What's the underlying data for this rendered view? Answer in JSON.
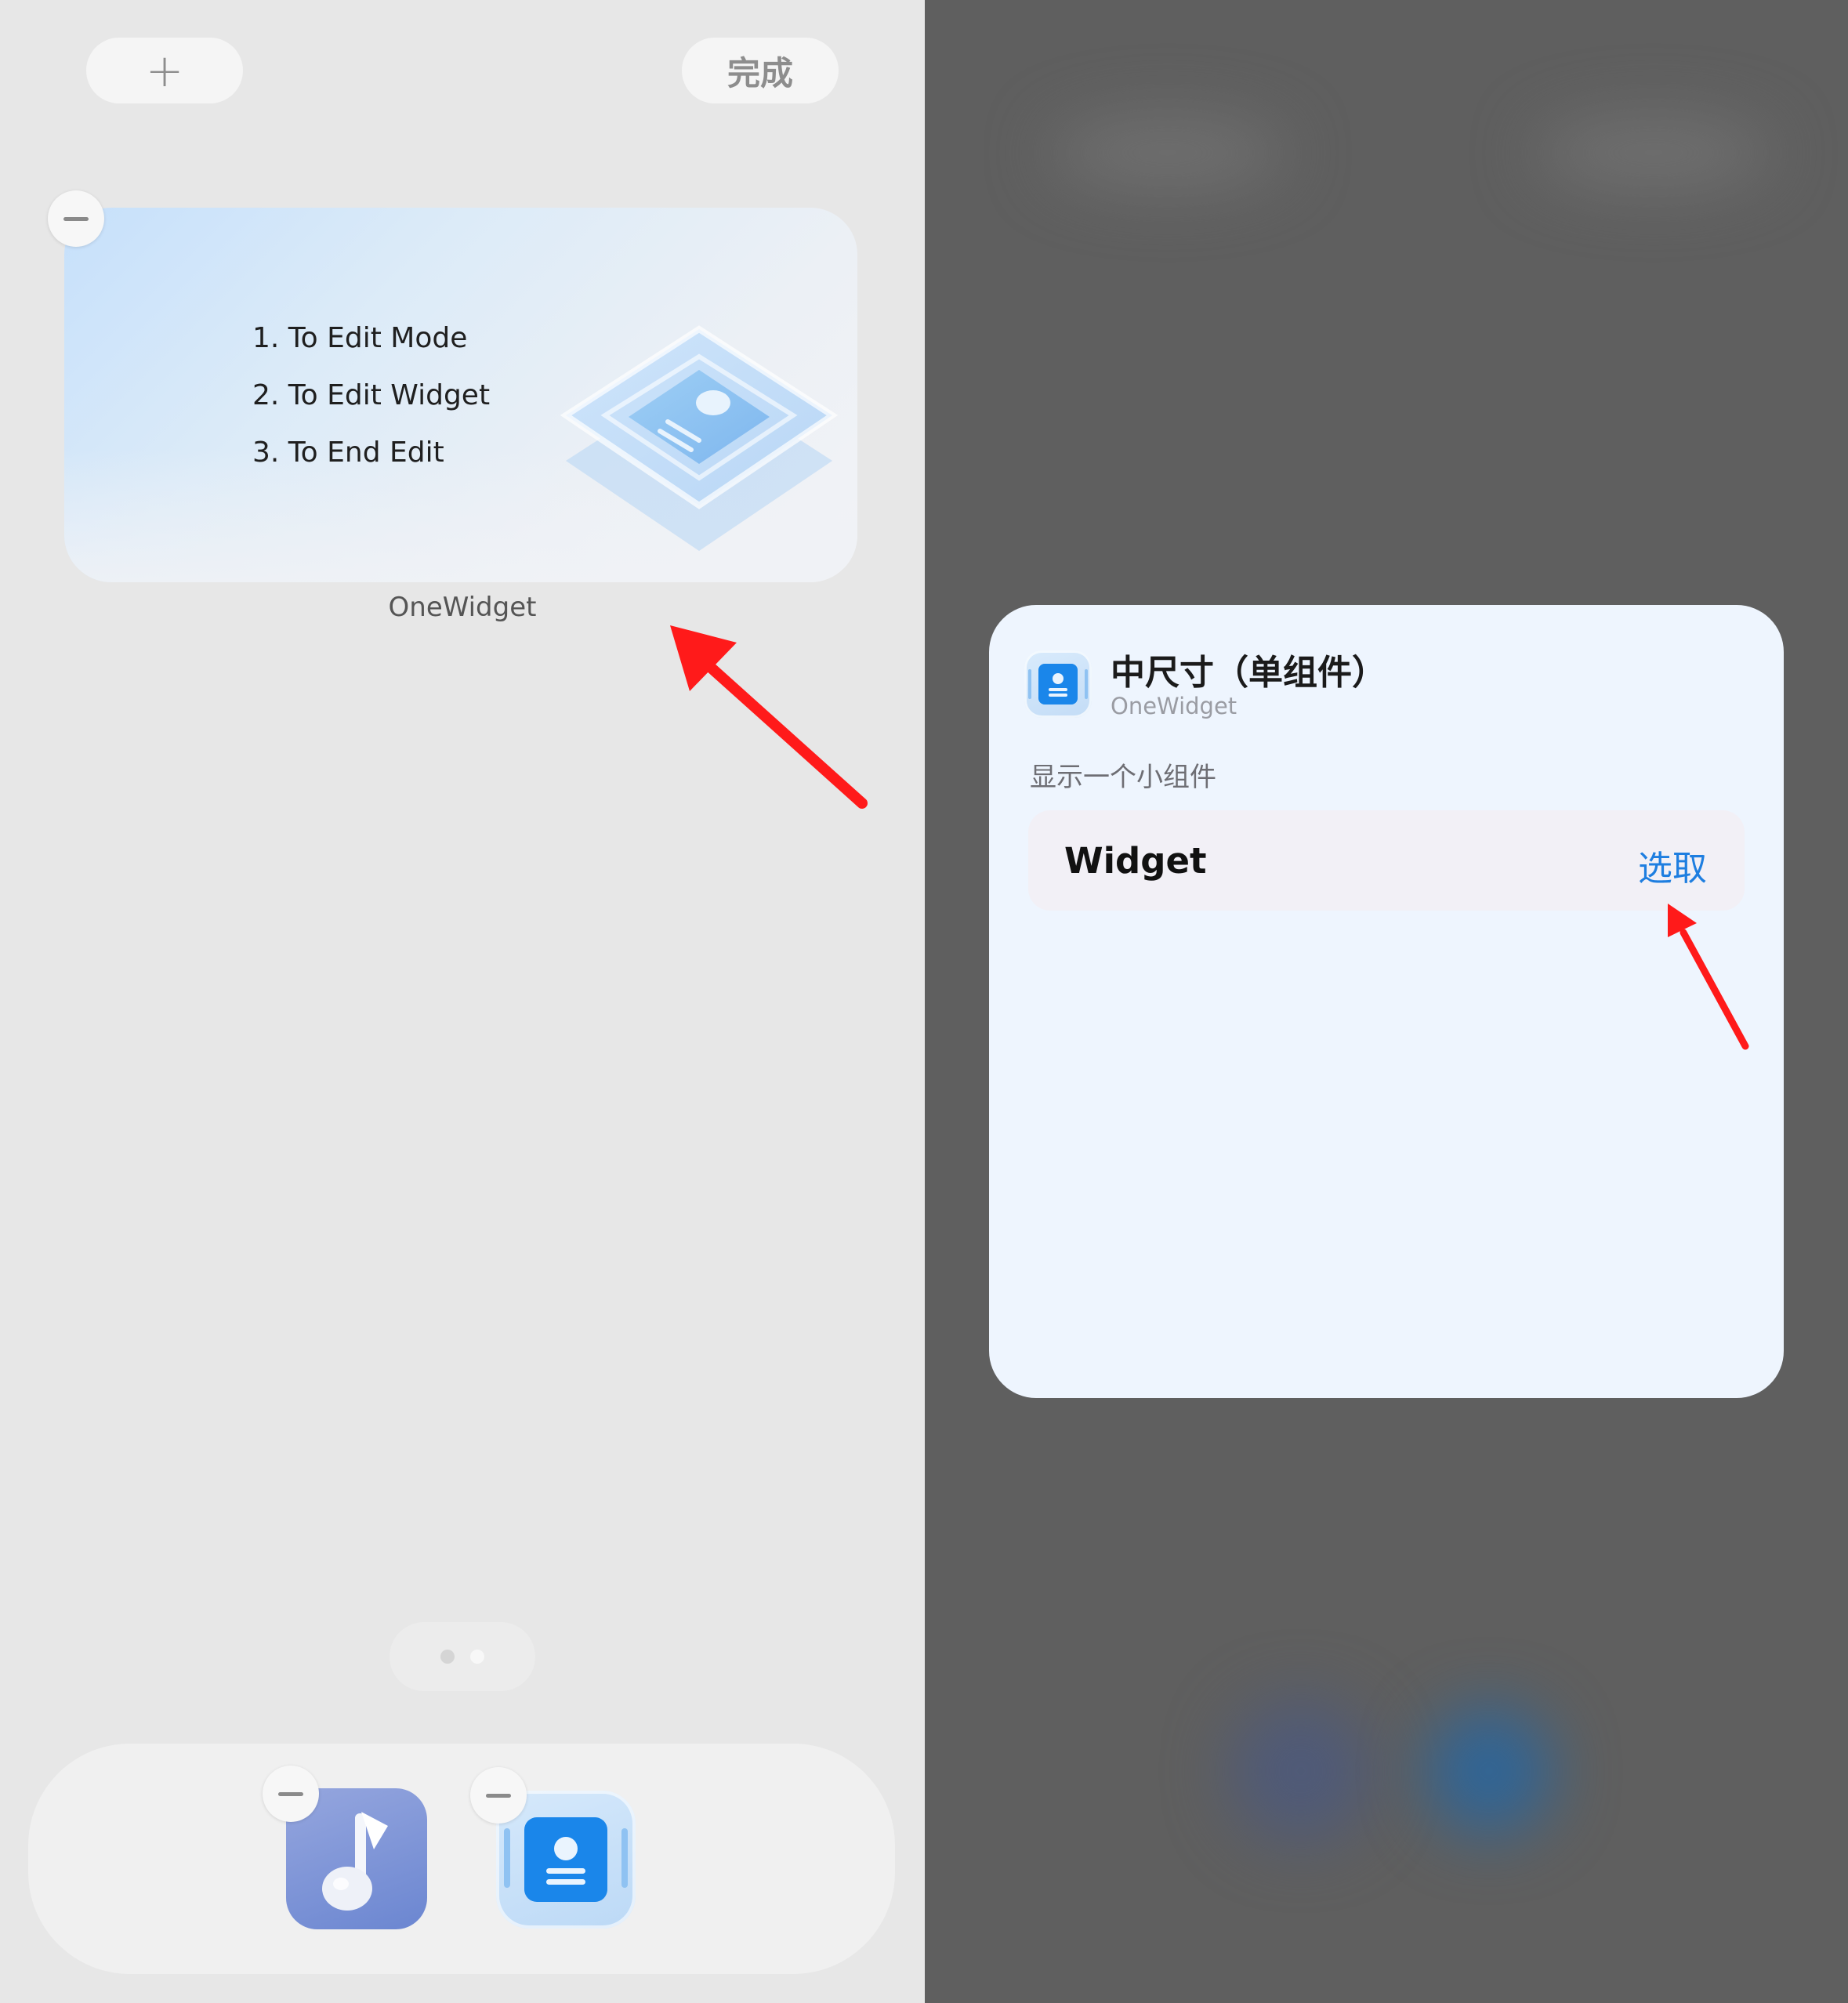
{
  "toolbar": {
    "add_label": "+",
    "done_label": "完成"
  },
  "widget": {
    "steps": [
      "1. To Edit Mode",
      "2. To Edit Widget",
      "3. To End Edit"
    ],
    "name": "OneWidget"
  },
  "page_indicator": {
    "pages": 2,
    "active_page": 2
  },
  "dock": {
    "apps": [
      "music-app-icon",
      "onewidget-app-icon"
    ]
  },
  "sheet": {
    "title": "中尺寸（单组件）",
    "subtitle": "OneWidget",
    "description": "显示一个小组件",
    "row_label": "Widget",
    "row_action": "选取"
  },
  "colors": {
    "accent": "#1e7ee0",
    "annotation_arrow": "#ff1a1a",
    "left_bg": "#e7e7e7",
    "right_bg": "#5f5f5f",
    "sheet_bg": "#eef5fe"
  }
}
